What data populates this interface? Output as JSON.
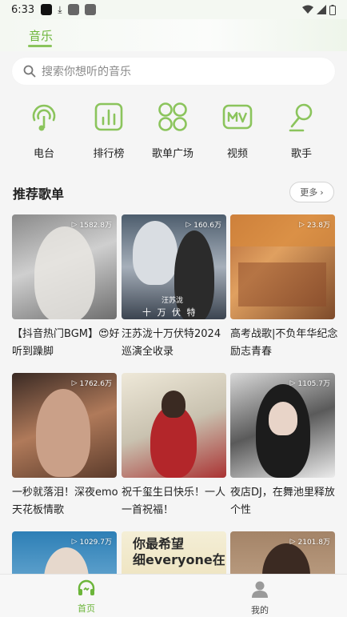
{
  "status": {
    "time": "6:33"
  },
  "header": {
    "tab": "音乐"
  },
  "search": {
    "placeholder": "搜索你想听的音乐"
  },
  "categories": [
    {
      "label": "电台",
      "icon": "radio-icon"
    },
    {
      "label": "排行榜",
      "icon": "chart-icon"
    },
    {
      "label": "歌单广场",
      "icon": "playlist-square-icon"
    },
    {
      "label": "视频",
      "icon": "mv-icon"
    },
    {
      "label": "歌手",
      "icon": "singer-icon"
    }
  ],
  "section": {
    "title": "推荐歌单",
    "more": "更多"
  },
  "playlists": [
    {
      "count": "1582.8万",
      "title": "【抖音热门BGM】😍好听到躁脚"
    },
    {
      "count": "160.6万",
      "title": "汪苏泷十万伏特2024巡演全收录",
      "cover_text": "十 万 伏 特",
      "cover_name": "汪苏泷"
    },
    {
      "count": "23.8万",
      "title": "高考战歌|不负年华纪念励志青春"
    },
    {
      "count": "1762.6万",
      "title": "一秒就落泪！深夜emo天花板情歌"
    },
    {
      "count": "",
      "title": "祝千玺生日快乐！一人一首祝福！"
    },
    {
      "count": "1105.7万",
      "title": "夜店DJ，在舞池里释放个性"
    },
    {
      "count": "1029.7万",
      "title": ""
    },
    {
      "count": "",
      "title": "",
      "cover_text": "你最希望细everyone在"
    },
    {
      "count": "2101.8万",
      "title": ""
    }
  ],
  "nav": {
    "home": "首页",
    "mine": "我的"
  },
  "colors": {
    "accent": "#6cb53a",
    "icon_green": "#8bc45c"
  }
}
